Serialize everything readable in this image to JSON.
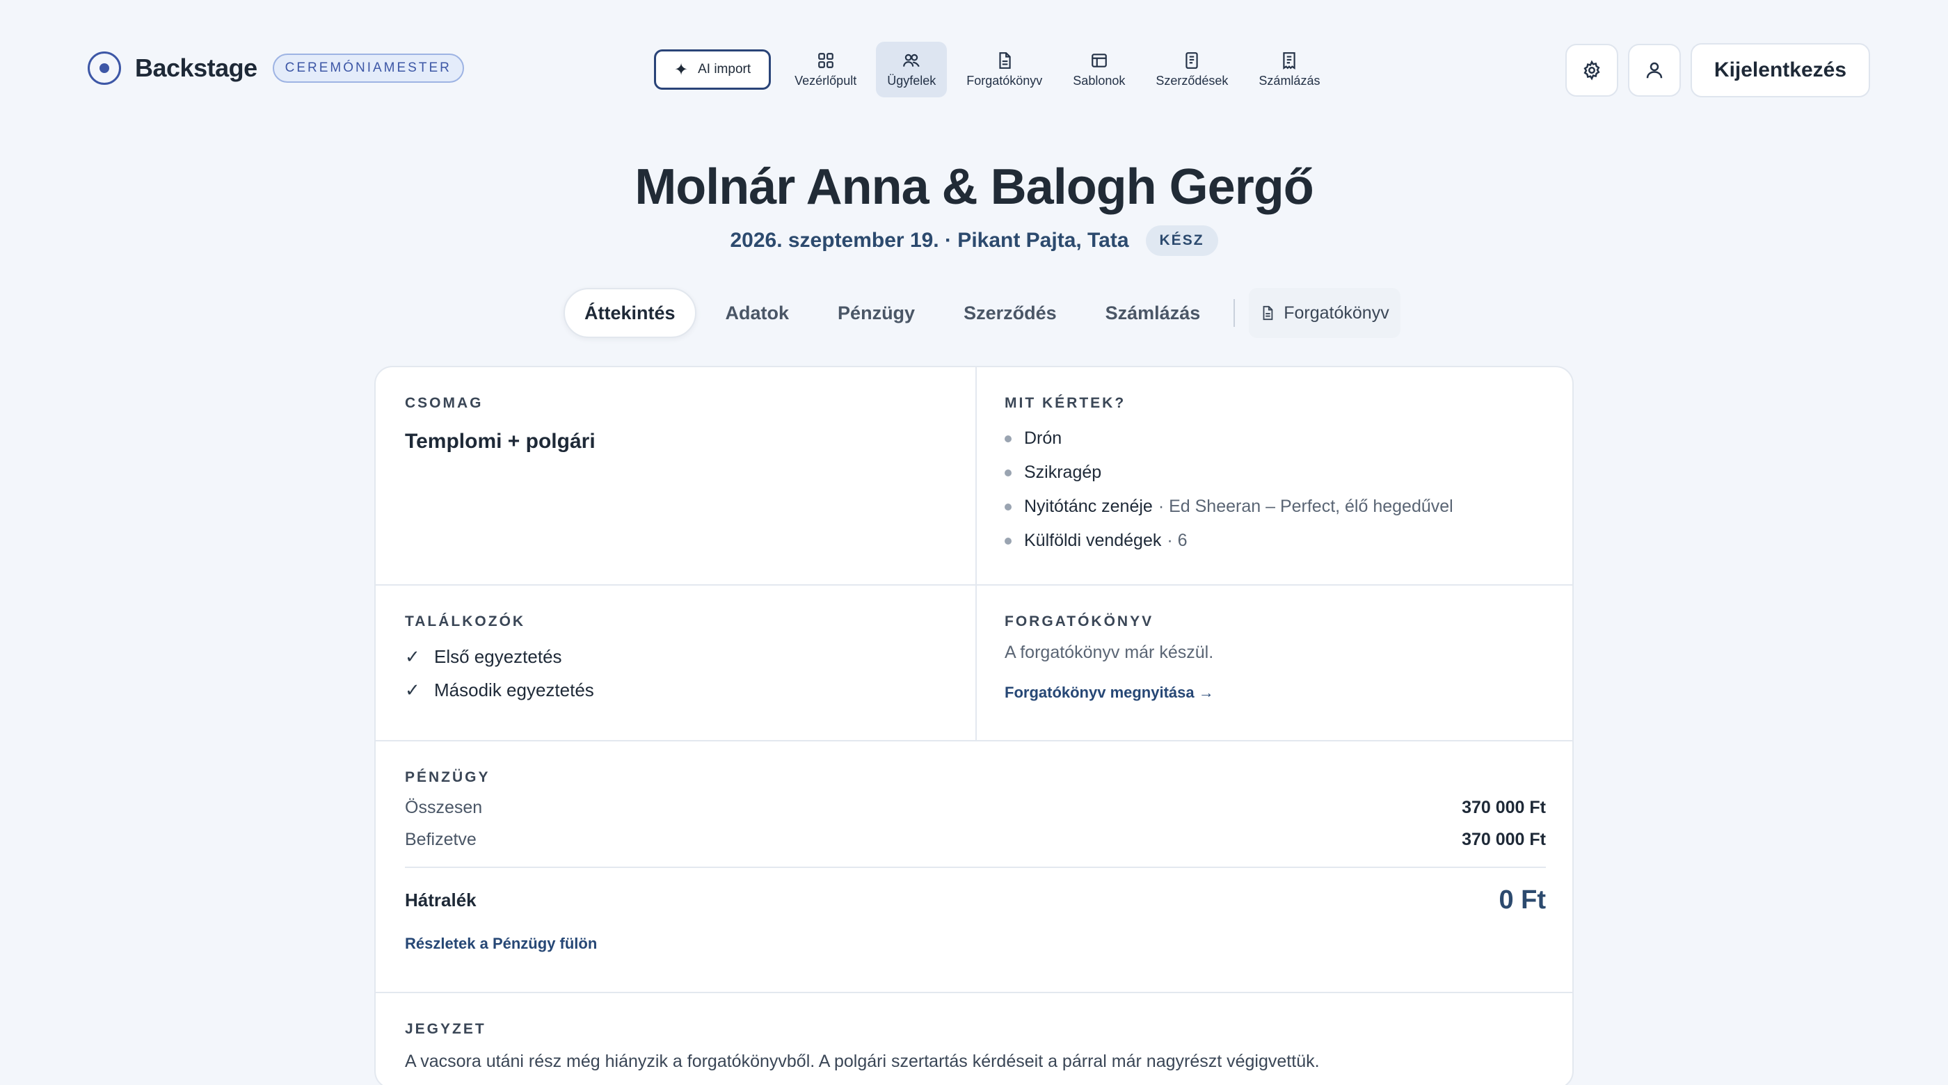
{
  "brand": {
    "name": "Backstage",
    "role": "CEREMÓNIAMESTER"
  },
  "nav": {
    "ai_import": "AI import",
    "items": [
      {
        "label": "Vezérlőpult",
        "icon": "grid-icon"
      },
      {
        "label": "Ügyfelek",
        "icon": "users-icon",
        "active": true
      },
      {
        "label": "Forgatókönyv",
        "icon": "document-icon"
      },
      {
        "label": "Sablonok",
        "icon": "template-icon"
      },
      {
        "label": "Szerződések",
        "icon": "contract-icon"
      },
      {
        "label": "Számlázás",
        "icon": "invoice-icon"
      }
    ]
  },
  "tools": {
    "logout": "Kijelentkezés"
  },
  "client": {
    "title": "Molnár Anna & Balogh Gergő",
    "subtitle": "2026. szeptember 19. · Pikant Pajta, Tata",
    "status": "KÉSZ"
  },
  "tabs": [
    "Áttekintés",
    "Adatok",
    "Pénzügy",
    "Szerződés",
    "Számlázás"
  ],
  "tab_script": "Forgatókönyv",
  "package": {
    "label": "CSOMAG",
    "value": "Templomi + polgári"
  },
  "requests": {
    "label": "MIT KÉRTEK?",
    "items": [
      {
        "text": "Drón",
        "detail": ""
      },
      {
        "text": "Szikragép",
        "detail": ""
      },
      {
        "text": "Nyitótánc zenéje",
        "detail": "· Ed Sheeran – Perfect, élő hegedűvel"
      },
      {
        "text": "Külföldi vendégek",
        "detail": "· 6"
      }
    ]
  },
  "meetings": {
    "label": "TALÁLKOZÓK",
    "items": [
      "Első egyeztetés",
      "Második egyeztetés"
    ]
  },
  "script": {
    "label": "FORGATÓKÖNYV",
    "text": "A forgatókönyv már készül.",
    "link": "Forgatókönyv megnyitása →"
  },
  "finance": {
    "label": "PÉNZÜGY",
    "total_label": "Összesen",
    "total_value": "370 000 Ft",
    "paid_label": "Befizetve",
    "paid_value": "370 000 Ft",
    "due_label": "Hátralék",
    "due_value": "0 Ft",
    "link": "Részletek a Pénzügy fülön"
  },
  "note": {
    "label": "JEGYZET",
    "text": "A vacsora utáni rész még hiányzik a forgatókönyvből. A polgári szertartás kérdéseit a párral már nagyrészt végigvettük."
  }
}
